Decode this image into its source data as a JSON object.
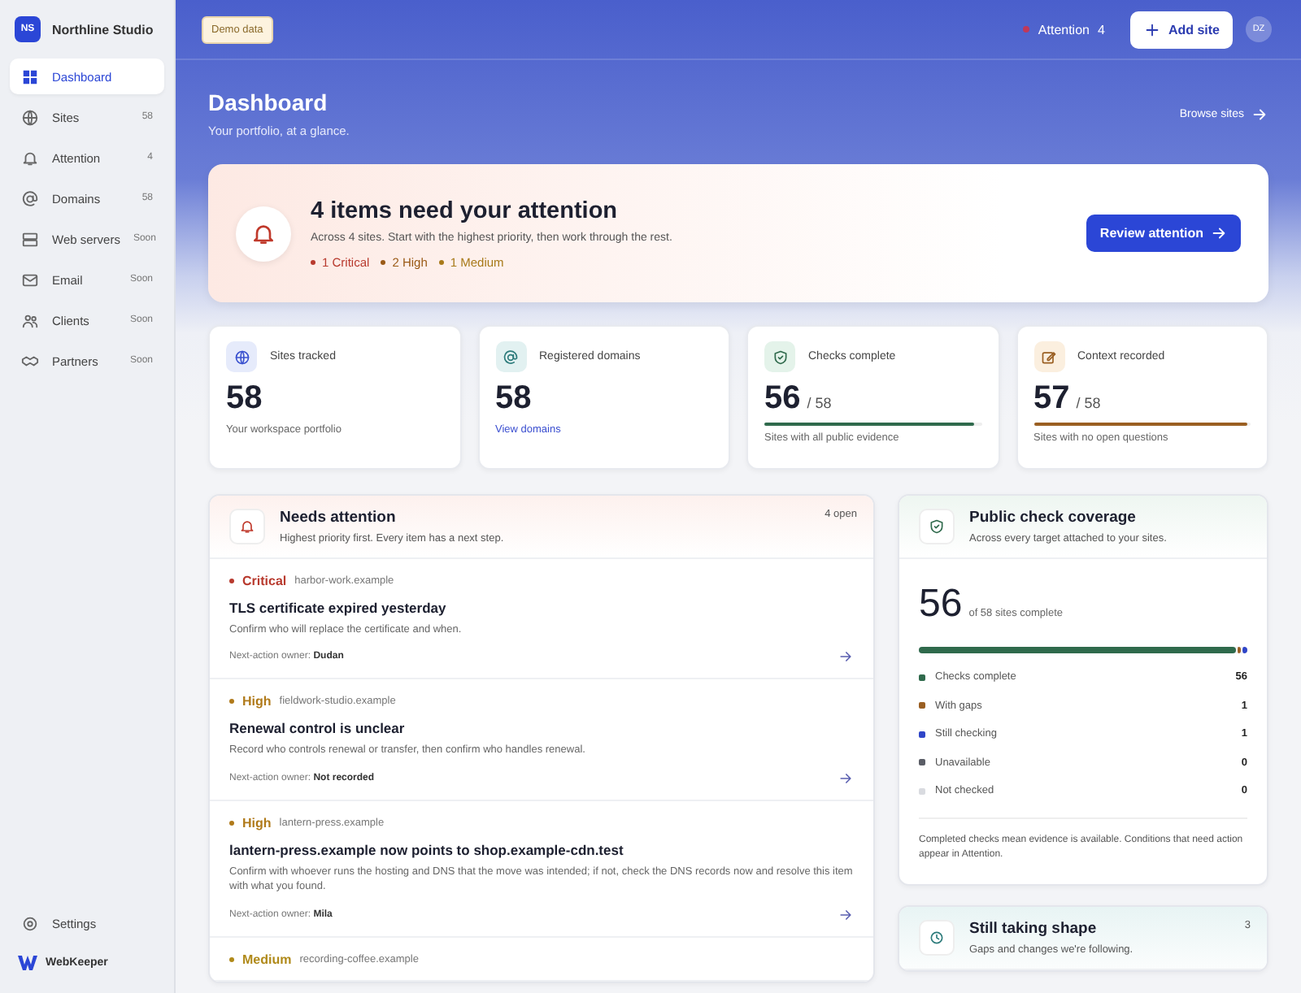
{
  "sidebar": {
    "brand": {
      "initials": "NS",
      "name": "Northline Studio"
    },
    "items": [
      {
        "label": "Dashboard",
        "selected": true
      },
      {
        "label": "Sites",
        "badge": "58",
        "selected": false
      },
      {
        "label": "Attention",
        "badge": "4",
        "selected": false
      },
      {
        "label": "Domains",
        "badge": "58",
        "selected": false
      },
      {
        "label": "Web servers",
        "badge": "Soon",
        "selected": false
      },
      {
        "label": "Email",
        "badge": "Soon",
        "selected": false
      },
      {
        "label": "Clients",
        "badge": "Soon",
        "selected": false
      },
      {
        "label": "Partners",
        "badge": "Soon",
        "selected": false
      }
    ],
    "settings": "Settings",
    "product": "WebKeeper"
  },
  "topbar": {
    "demo_badge": "Demo data",
    "attention_label": "Attention",
    "attention_count": "4",
    "add_button": "Add site",
    "avatar": "DZ"
  },
  "header": {
    "title": "Dashboard",
    "subtitle": "Your portfolio, at a glance.",
    "link": "Browse sites"
  },
  "alert": {
    "title": "4 items need your attention",
    "text": "Across 4 sites. Start with the highest priority, then work through the rest.",
    "severities": [
      {
        "label": "1 Critical",
        "color": "#b83a2e"
      },
      {
        "label": "2 High",
        "color": "#9a5a16"
      },
      {
        "label": "1 Medium",
        "color": "#a87a1a"
      }
    ],
    "button": "Review attention"
  },
  "stats": [
    {
      "kind": "plain",
      "label": "Sites tracked",
      "value": "58",
      "note": "Your workspace portfolio"
    },
    {
      "kind": "link",
      "label": "Registered domains",
      "value": "58",
      "note": "View domains"
    },
    {
      "kind": "progress",
      "label": "Checks complete",
      "value": "56",
      "total": "/ 58",
      "level": 0.966,
      "color": "#2f6a4c",
      "note": "Sites with all public evidence"
    },
    {
      "kind": "progress",
      "label": "Context recorded",
      "value": "57",
      "total": "/ 58",
      "level": 0.983,
      "color": "#9a5f22",
      "note": "Sites with no open questions"
    }
  ],
  "attention_panel": {
    "title": "Needs attention",
    "subtitle": "Highest priority first. Every item has a next step.",
    "count": "4 open",
    "items": [
      {
        "severity": "Critical",
        "color": "#b83a2e",
        "domain": "harbor-work.example",
        "title": "TLS certificate expired yesterday",
        "text": "Confirm who will replace the certificate and when.",
        "owner": "Next-action owner: **Dudan**"
      },
      {
        "severity": "High",
        "color": "#b07a1a",
        "domain": "fieldwork-studio.example",
        "title": "Renewal control is unclear",
        "text": "Record who controls renewal or transfer, then confirm who handles renewal.",
        "owner": "Next-action owner: **Not recorded**"
      },
      {
        "severity": "High",
        "color": "#b07a1a",
        "domain": "lantern-press.example",
        "title": "lantern-press.example now points to shop.example-cdn.test",
        "text": "Confirm with whoever runs the hosting and DNS that the move was intended; if not, check the DNS records now and resolve this item with what you found.",
        "owner": "Next-action owner: **Mila**"
      },
      {
        "severity": "Medium",
        "color": "#b08a1a",
        "domain": "recording-coffee.example"
      }
    ]
  },
  "coverage": {
    "title": "Public check coverage",
    "subtitle": "Across every target attached to your sites.",
    "value": "56",
    "value_note": "of 58 sites complete",
    "legend": [
      {
        "label": "Checks complete",
        "count": "56",
        "color": "#2f6a4c",
        "level": 0.9655
      },
      {
        "label": "With gaps",
        "count": "1",
        "color": "#9a5f22",
        "level": 0.0172
      },
      {
        "label": "Still checking",
        "count": "1",
        "color": "#2f45c8",
        "level": 0.0172
      },
      {
        "label": "Unavailable",
        "count": "0",
        "color": "#5a5d66"
      },
      {
        "label": "Not checked",
        "count": "0",
        "color": "#d9dbe0"
      }
    ],
    "footnote": "Completed checks mean evidence is available. Conditions that need action appear in Attention."
  },
  "shaping": {
    "title": "Still taking shape",
    "subtitle": "Gaps and changes we're following.",
    "count": "3"
  }
}
